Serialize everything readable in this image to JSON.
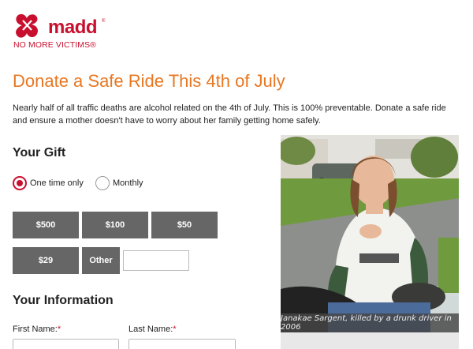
{
  "brand": {
    "name": "madd",
    "registered": "®",
    "tagline": "NO MORE VICTIMS®",
    "color": "#c8102e"
  },
  "page": {
    "title": "Donate a Safe Ride This 4th of July",
    "title_color": "#e87722",
    "intro": "Nearly half of all traffic deaths are alcohol related on the 4th of July. This is 100% preventable. Donate a safe ride and ensure a mother doesn't have to worry about her family getting home safely."
  },
  "gift": {
    "heading": "Your Gift",
    "frequency": {
      "options": [
        "One time only",
        "Monthly"
      ],
      "selected": "One time only"
    },
    "amounts": [
      "$500",
      "$100",
      "$50",
      "$29"
    ],
    "other_label": "Other",
    "other_value": "",
    "button_color": "#666666"
  },
  "info": {
    "heading": "Your Information",
    "first_name_label": "First Name:",
    "last_name_label": "Last Name:",
    "required_marker": "*",
    "first_name_value": "",
    "last_name_value": ""
  },
  "photo": {
    "caption": "Janakae Sargent, killed by a drunk driver in 2006"
  }
}
